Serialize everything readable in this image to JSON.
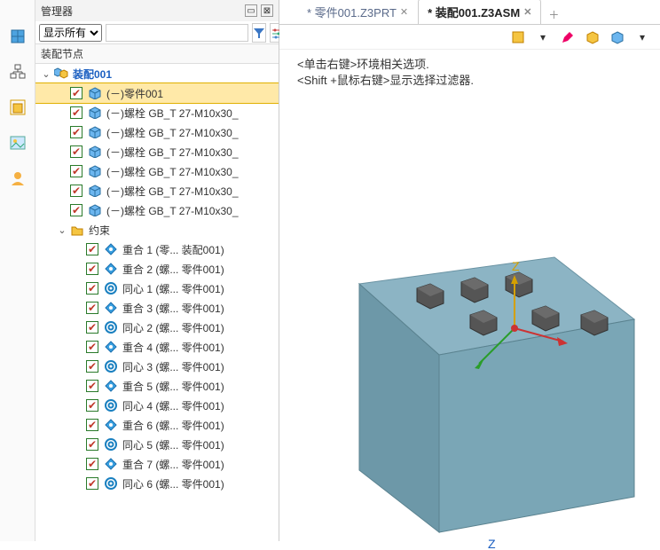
{
  "panel": {
    "title": "管理器",
    "display_mode": "显示所有",
    "search_placeholder": "",
    "section_title": "装配节点"
  },
  "tree": {
    "root": {
      "label": "装配001",
      "expanded": true
    },
    "parts": [
      {
        "label": "(－)零件001",
        "selected": true
      },
      {
        "label": "(－)螺栓 GB_T 27-M10x30_"
      },
      {
        "label": "(－)螺栓 GB_T 27-M10x30_"
      },
      {
        "label": "(－)螺栓 GB_T 27-M10x30_"
      },
      {
        "label": "(－)螺栓 GB_T 27-M10x30_"
      },
      {
        "label": "(－)螺栓 GB_T 27-M10x30_"
      },
      {
        "label": "(－)螺栓 GB_T 27-M10x30_"
      }
    ],
    "constraints_folder": {
      "label": "约束",
      "expanded": true
    },
    "constraints": [
      {
        "icon": "coincident",
        "label": "重合 1 (零... 装配001)"
      },
      {
        "icon": "coincident",
        "label": "重合 2 (螺... 零件001)"
      },
      {
        "icon": "concentric",
        "label": "同心 1 (螺... 零件001)"
      },
      {
        "icon": "coincident",
        "label": "重合 3 (螺... 零件001)"
      },
      {
        "icon": "concentric",
        "label": "同心 2 (螺... 零件001)"
      },
      {
        "icon": "coincident",
        "label": "重合 4 (螺... 零件001)"
      },
      {
        "icon": "concentric",
        "label": "同心 3 (螺... 零件001)"
      },
      {
        "icon": "coincident",
        "label": "重合 5 (螺... 零件001)"
      },
      {
        "icon": "concentric",
        "label": "同心 4 (螺... 零件001)"
      },
      {
        "icon": "coincident",
        "label": "重合 6 (螺... 零件001)"
      },
      {
        "icon": "concentric",
        "label": "同心 5 (螺... 零件001)"
      },
      {
        "icon": "coincident",
        "label": "重合 7 (螺... 零件001)"
      },
      {
        "icon": "concentric",
        "label": "同心 6 (螺... 零件001)"
      }
    ]
  },
  "tabs": [
    {
      "label": "* 零件001.Z3PRT",
      "active": false
    },
    {
      "label": "* 装配001.Z3ASM",
      "active": true
    }
  ],
  "hints": {
    "line1": "<单击右键>环境相关选项.",
    "line2": "<Shift +鼠标右键>显示选择过滤器."
  },
  "axis_label": "Z",
  "bottom_axis_label": "Z"
}
